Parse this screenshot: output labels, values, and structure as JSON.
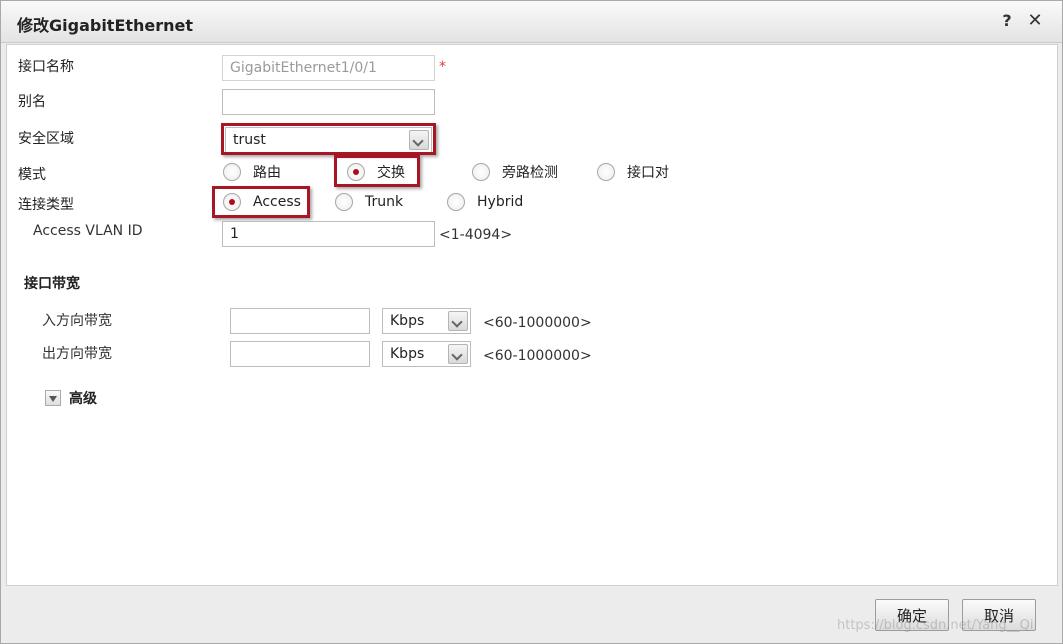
{
  "dialog": {
    "title": "修改GigabitEthernet",
    "help_icon": "?",
    "close_icon": "✕"
  },
  "form": {
    "interface_name": {
      "label": "接口名称",
      "value": "GigabitEthernet1/0/1",
      "required_mark": "*"
    },
    "alias": {
      "label": "别名",
      "value": ""
    },
    "security_zone": {
      "label": "安全区域",
      "value": "trust"
    },
    "mode": {
      "label": "模式",
      "options": [
        {
          "label": "路由",
          "checked": false
        },
        {
          "label": "交换",
          "checked": true
        },
        {
          "label": "旁路检测",
          "checked": false
        },
        {
          "label": "接口对",
          "checked": false
        }
      ]
    },
    "link_type": {
      "label": "连接类型",
      "options": [
        {
          "label": "Access",
          "checked": true
        },
        {
          "label": "Trunk",
          "checked": false
        },
        {
          "label": "Hybrid",
          "checked": false
        }
      ]
    },
    "access_vlan": {
      "label": "Access VLAN ID",
      "value": "1",
      "hint": "<1-4094>"
    }
  },
  "bandwidth": {
    "title": "接口带宽",
    "inbound": {
      "label": "入方向带宽",
      "value": "",
      "unit": "Kbps",
      "hint": "<60-1000000>"
    },
    "outbound": {
      "label": "出方向带宽",
      "value": "",
      "unit": "Kbps",
      "hint": "<60-1000000>"
    }
  },
  "advanced": {
    "label": "高级"
  },
  "footer": {
    "ok_label": "确定",
    "cancel_label": "取消",
    "watermark": "https://blog.csdn.net/Yang__Qi"
  },
  "colors": {
    "highlight": "#a81626",
    "radio_dot": "#b00b1e",
    "required": "#e23b3b"
  }
}
